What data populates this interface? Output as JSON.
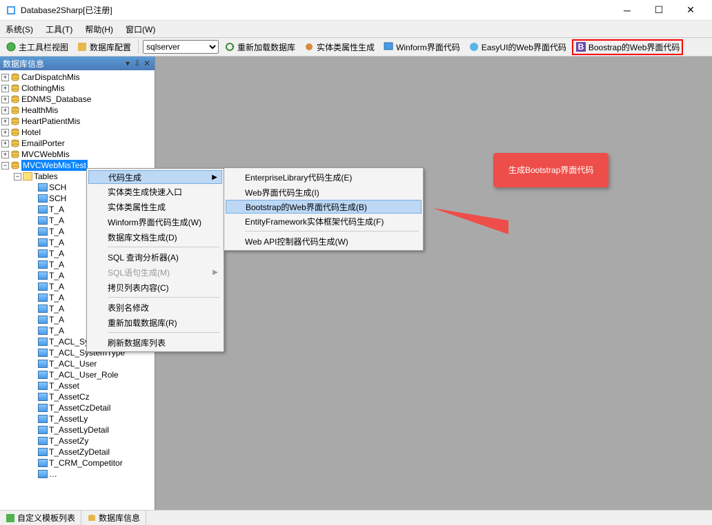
{
  "titlebar": {
    "title": "Database2Sharp[已注册]"
  },
  "menubar": {
    "items": [
      "系统(S)",
      "工具(T)",
      "帮助(H)",
      "窗口(W)"
    ]
  },
  "toolbar": {
    "main_view": "主工具栏视图",
    "db_config": "数据库配置",
    "db_select_value": "sqlserver",
    "reload_db": "重新加载数据库",
    "entity_attr_gen": "实体类属性生成",
    "winform_code": "Winform界面代码",
    "easyui_code": "EasyUI的Web界面代码",
    "bootstrap_code": "Boostrap的Web界面代码"
  },
  "panel": {
    "title": "数据库信息"
  },
  "tree": {
    "dbs": [
      "CarDispatchMis",
      "ClothingMis",
      "EDNMS_Database",
      "HealthMis",
      "HeartPatientMis",
      "Hotel",
      "EmailPorter",
      "MVCWebMis"
    ],
    "selected_db": "MVCWebMisTest",
    "tables_label": "Tables",
    "tables_partial": [
      "SCH",
      "SCH",
      "T_A",
      "T_A",
      "T_A",
      "T_A",
      "T_A",
      "T_A",
      "T_A",
      "T_A",
      "T_A",
      "T_A",
      "T_A",
      "T_A"
    ],
    "tables_rest": [
      "T_ACL_SystemAuthori",
      "T_ACL_SystemType",
      "T_ACL_User",
      "T_ACL_User_Role",
      "T_Asset",
      "T_AssetCz",
      "T_AssetCzDetail",
      "T_AssetLy",
      "T_AssetLyDetail",
      "T_AssetZy",
      "T_AssetZyDetail",
      "T_CRM_Competitor"
    ]
  },
  "context_menu": {
    "items": [
      {
        "label": "代码生成",
        "arrow": true,
        "highlight": true
      },
      {
        "label": "实体类生成快速入口"
      },
      {
        "label": "实体类属性生成"
      },
      {
        "label": "Winform界面代码生成(W)"
      },
      {
        "label": "数据库文档生成(D)"
      },
      {
        "sep": true
      },
      {
        "label": "SQL 查询分析器(A)"
      },
      {
        "label": "SQL语句生成(M)",
        "arrow": true,
        "disabled": true
      },
      {
        "label": "拷贝列表内容(C)"
      },
      {
        "sep": true
      },
      {
        "label": "表别名修改"
      },
      {
        "label": "重新加载数据库(R)"
      },
      {
        "sep": true
      },
      {
        "label": "刷新数据库列表"
      }
    ]
  },
  "submenu": {
    "items": [
      {
        "label": "EnterpriseLibrary代码生成(E)"
      },
      {
        "label": "Web界面代码生成(I)"
      },
      {
        "label": "Bootstrap的Web界面代码生成(B)",
        "red": true,
        "highlight": true
      },
      {
        "label": "EntityFramework实体框架代码生成(F)"
      },
      {
        "sep": true
      },
      {
        "label": "Web API控制器代码生成(W)"
      }
    ]
  },
  "callout": {
    "text": "生成Bootstrap界面代码"
  },
  "bottom_tabs": {
    "custom": "自定义模板列表",
    "dbinfo": "数据库信息"
  }
}
